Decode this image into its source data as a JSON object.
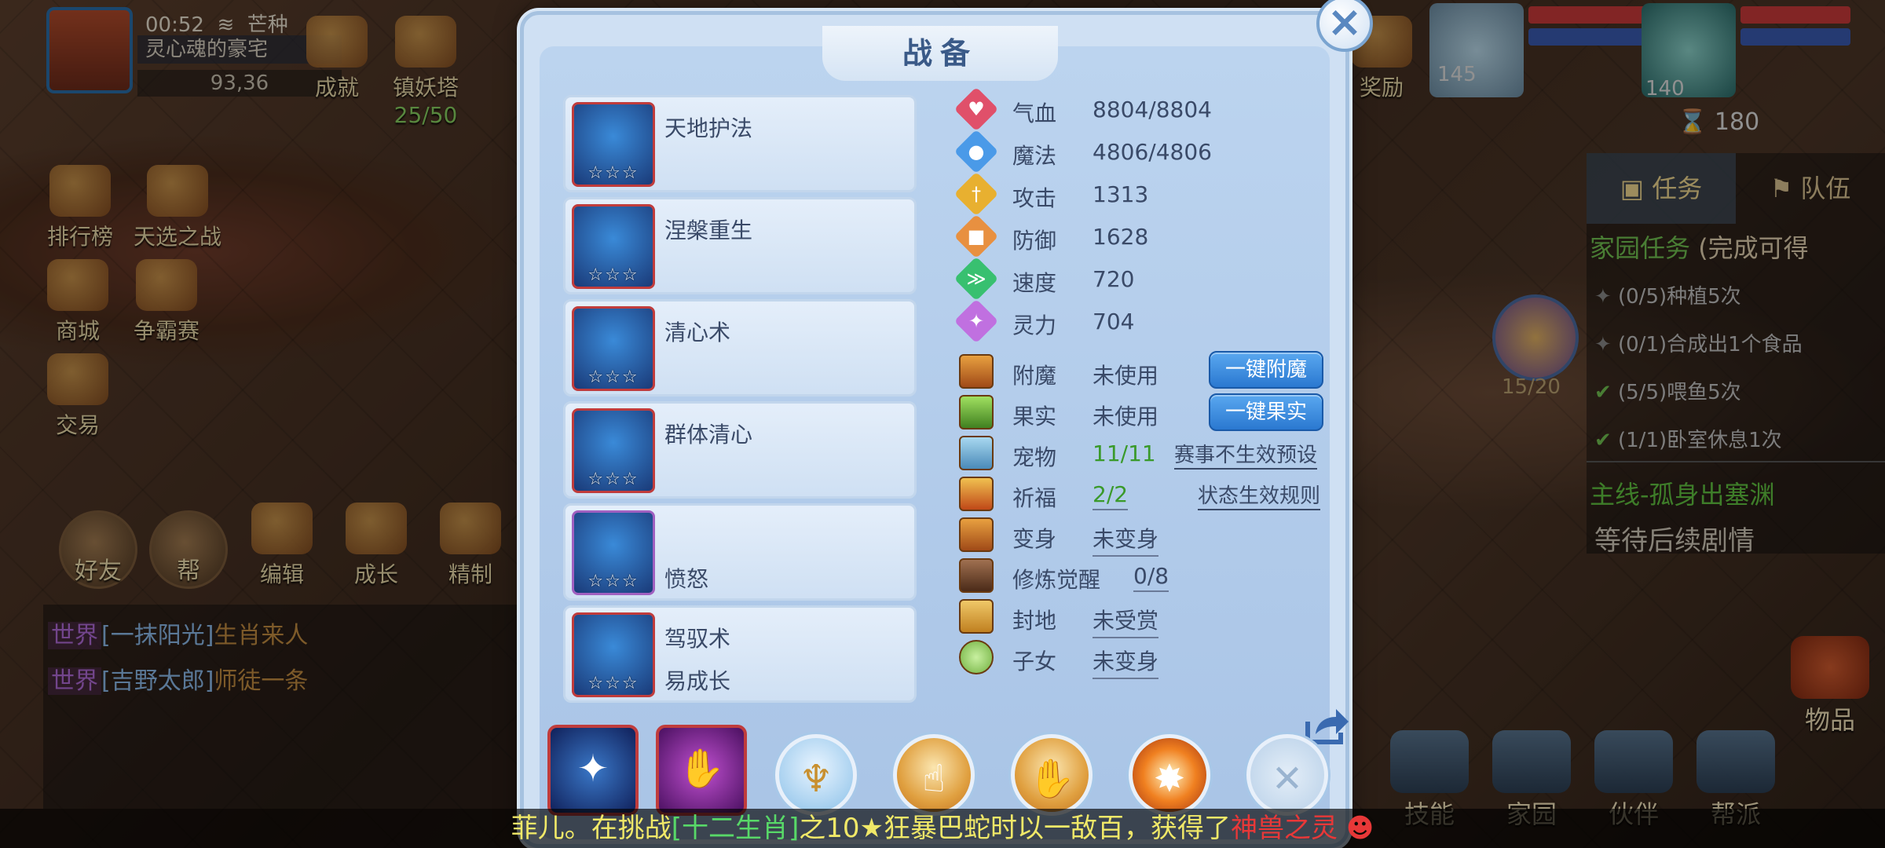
{
  "status": {
    "time": "00:52",
    "solar_term": "芒种",
    "location": "灵心魂的豪宅",
    "coords": "93,36"
  },
  "hud_top": [
    {
      "label": "成就"
    },
    {
      "label": "镇妖塔",
      "sub": "25/50"
    },
    {
      "label": "奖励"
    }
  ],
  "left_menu": [
    "排行榜",
    "天选之战",
    "商城",
    "争霸赛",
    "交易"
  ],
  "bottom_left": [
    "好友",
    "帮",
    "编辑",
    "成长",
    "精制"
  ],
  "chat": [
    {
      "channel": "世界",
      "name": "[一抹阳光]",
      "msg": "生肖来人"
    },
    {
      "channel": "世界",
      "name": "[吉野太郎]",
      "msg": "师徒一条"
    }
  ],
  "party": {
    "pet_level": "145",
    "hero_level": "140",
    "timer": "180",
    "pet_counter": "15/20"
  },
  "quest_panel": {
    "tab_task": "任务",
    "tab_team": "队伍",
    "family_title": "家园任务",
    "family_suffix": "(完成可得",
    "items": [
      {
        "done": false,
        "text": "(0/5)种植5次"
      },
      {
        "done": false,
        "text": "(0/1)合成出1个食品"
      },
      {
        "done": true,
        "text": "(5/5)喂鱼5次"
      },
      {
        "done": true,
        "text": "(1/1)卧室休息1次"
      }
    ],
    "main_title": "主线-孤身出塞渊",
    "main_desc": "等待后续剧情"
  },
  "bottom_right": [
    "技能",
    "家园",
    "伙伴",
    "帮派",
    "物品"
  ],
  "panel": {
    "title": "战备",
    "skills": [
      {
        "name": "天地护法",
        "sub": "",
        "stars": "☆☆☆"
      },
      {
        "name": "涅槃重生",
        "sub": "",
        "stars": "☆☆☆"
      },
      {
        "name": "清心术",
        "sub": "",
        "stars": "☆☆☆"
      },
      {
        "name": "群体清心",
        "sub": "",
        "stars": "☆☆☆"
      },
      {
        "name": "",
        "sub": "愤怒",
        "stars": "☆☆☆"
      },
      {
        "name": "驾驭术",
        "sub": "易成长",
        "stars": "☆☆☆"
      }
    ],
    "stats": [
      {
        "label": "气血",
        "value": "8804/8804",
        "color": "#e0506a",
        "glyph": "♥"
      },
      {
        "label": "魔法",
        "value": "4806/4806",
        "color": "#4a9ae8",
        "glyph": "●"
      },
      {
        "label": "攻击",
        "value": "1313",
        "color": "#e8b030",
        "glyph": "†"
      },
      {
        "label": "防御",
        "value": "1628",
        "color": "#e89040",
        "glyph": "■"
      },
      {
        "label": "速度",
        "value": "720",
        "color": "#38c070",
        "glyph": "≫"
      },
      {
        "label": "灵力",
        "value": "704",
        "color": "#c070e0",
        "glyph": "✦"
      }
    ],
    "equip": [
      {
        "label": "附魔",
        "value": "未使用",
        "style": ""
      },
      {
        "label": "果实",
        "value": "未使用",
        "style": ""
      },
      {
        "label": "宠物",
        "value": "11/11",
        "style": "green"
      },
      {
        "label": "祈福",
        "value": "2/2",
        "style": "green u"
      },
      {
        "label": "变身",
        "value": "未变身",
        "style": "u"
      },
      {
        "label": "修炼觉醒",
        "value": "0/8",
        "style": "u"
      },
      {
        "label": "封地",
        "value": "未受赏",
        "style": "u"
      },
      {
        "label": "子女",
        "value": "未变身",
        "style": "u"
      }
    ],
    "btn_enchant": "一键附魔",
    "btn_fruit": "一键果实",
    "link_preset": "赛事不生效预设",
    "link_rules": "状态生效规则"
  },
  "broadcast": {
    "p1": "菲儿。在挑战",
    "p2": "[十二生肖]",
    "p3": "之10★狂暴巴蛇",
    "p4": "时以一敌百，获得了",
    "p5": "神兽之灵"
  }
}
